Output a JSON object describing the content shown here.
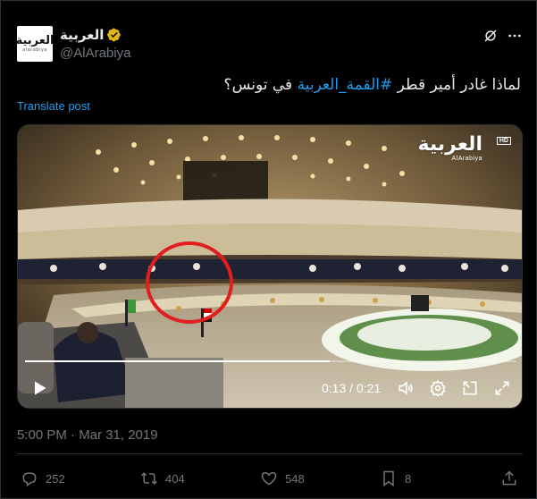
{
  "account": {
    "display_name": "العربية",
    "handle": "@AlArabiya",
    "avatar_logo_ar": "العربية",
    "avatar_logo_en": "alarabiya",
    "verified_color": "#e2b719"
  },
  "post": {
    "text_prefix": "لماذا غادر أمير قطر ",
    "hashtag": "#القمة_العربية",
    "text_suffix": " في تونس؟",
    "translate_label": "Translate post",
    "timestamp": "5:00 PM · Mar 31, 2019"
  },
  "video": {
    "channel_logo_ar": "العربية",
    "channel_logo_en": "AlArabiya",
    "hd_label": "HD",
    "current_time": "0:13",
    "duration": "0:21",
    "time_display": "0:13 / 0:21",
    "progress_fraction": 0.62,
    "highlight_color": "#e01e1e"
  },
  "actions": {
    "replies": "252",
    "reposts": "404",
    "likes": "548",
    "bookmarks": "8"
  },
  "icons": {
    "grok": "grok-icon",
    "more": "more-icon",
    "play": "play-icon",
    "volume": "volume-icon",
    "settings": "gear-icon",
    "pip": "pip-icon",
    "fullscreen": "fullscreen-icon",
    "reply": "reply-icon",
    "repost": "repost-icon",
    "like": "heart-icon",
    "bookmark": "bookmark-icon",
    "share": "share-icon"
  },
  "colors": {
    "background": "#000000",
    "text_primary": "#e7e9ea",
    "text_secondary": "#71767b",
    "link": "#1d9bf0",
    "border": "#2f3336"
  }
}
